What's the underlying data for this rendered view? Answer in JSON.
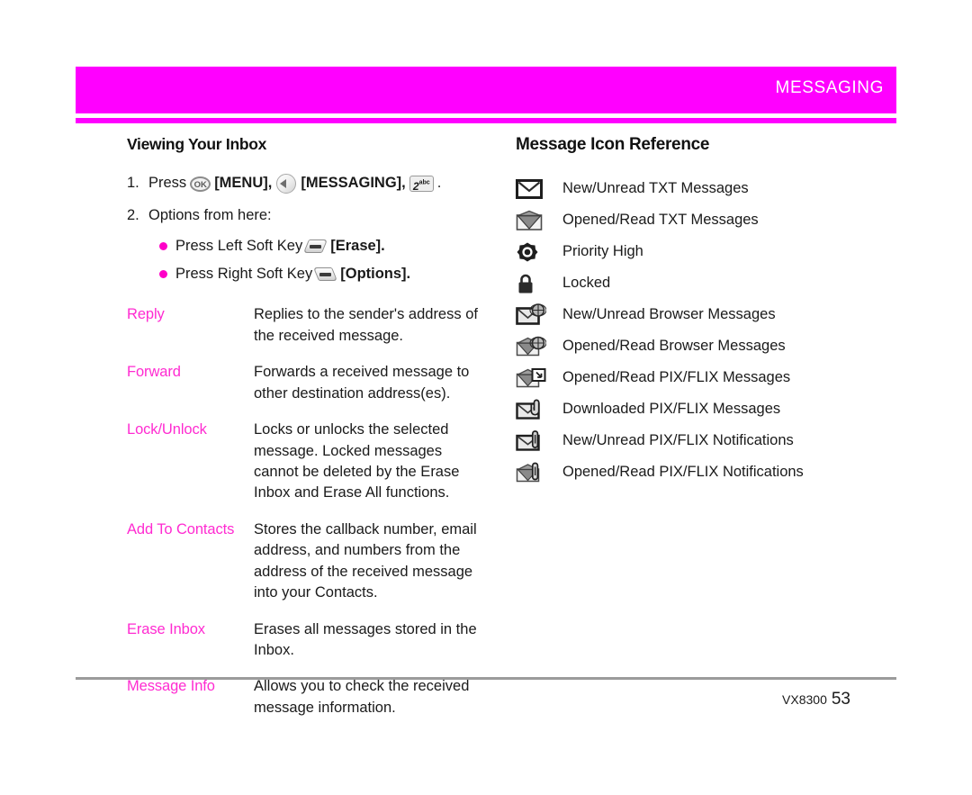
{
  "header": {
    "title": "MESSAGING",
    "band_color": "#ff00ff",
    "title_color": "#ffffff"
  },
  "left_column": {
    "section_title": "Viewing Your Inbox",
    "steps": [
      {
        "number": "1.",
        "prefix": "Press",
        "key_ok_label": "OK",
        "label_menu": "[MENU],",
        "key_nav_name": "left-arrow-navigation-key",
        "label_messaging": "[MESSAGING],",
        "key_num_digit": "2",
        "key_num_letters": "abc",
        "suffix": "."
      },
      {
        "number": "2.",
        "text": "Options from here:"
      }
    ],
    "bullets": [
      {
        "prefix": "Press Left Soft Key",
        "key": "left-soft-key",
        "label": "[Erase]."
      },
      {
        "prefix": "Press Right Soft Key",
        "key": "right-soft-key",
        "label": "[Options]."
      }
    ],
    "definitions": [
      {
        "term": "Reply",
        "description": "Replies to the sender's address of the received message."
      },
      {
        "term": "Forward",
        "description": "Forwards a received message to other destination address(es)."
      },
      {
        "term": "Lock/Unlock",
        "description": "Locks or unlocks the selected message. Locked messages cannot be deleted by the Erase Inbox and Erase All functions."
      },
      {
        "term": "Add To Contacts",
        "description": "Stores the callback number, email address, and numbers from the address of the received message into your Contacts."
      },
      {
        "term": "Erase Inbox",
        "description": "Erases all messages stored in the Inbox."
      },
      {
        "term": "Message Info",
        "description": "Allows you to check the received message information."
      }
    ],
    "term_color": "#ff2bd1"
  },
  "right_column": {
    "section_title": "Message Icon Reference",
    "icons": [
      {
        "icon": "closed-envelope-icon",
        "label": "New/Unread TXT Messages"
      },
      {
        "icon": "open-envelope-icon",
        "label": "Opened/Read TXT Messages"
      },
      {
        "icon": "priority-high-icon",
        "label": "Priority High"
      },
      {
        "icon": "padlock-icon",
        "label": "Locked"
      },
      {
        "icon": "closed-envelope-globe-icon",
        "label": "New/Unread Browser Messages"
      },
      {
        "icon": "open-envelope-globe-icon",
        "label": "Opened/Read Browser Messages"
      },
      {
        "icon": "open-envelope-download-box-icon",
        "label": "Opened/Read PIX/FLIX Messages"
      },
      {
        "icon": "closed-envelope-paperclip-icon",
        "label": "Downloaded PIX/FLIX Messages"
      },
      {
        "icon": "closed-envelope-pin-icon",
        "label": "New/Unread PIX/FLIX Notifications"
      },
      {
        "icon": "open-envelope-pin-icon",
        "label": "Opened/Read PIX/FLIX Notifications"
      }
    ]
  },
  "footer": {
    "model": "VX8300",
    "page_number": "53"
  }
}
